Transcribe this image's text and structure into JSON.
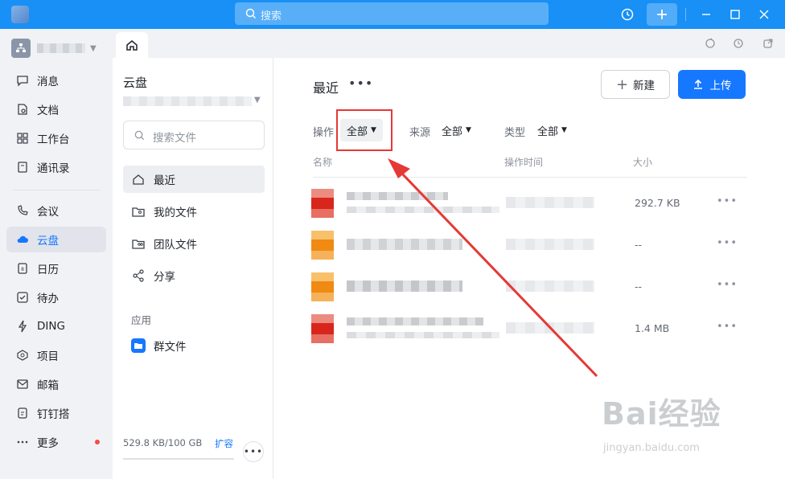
{
  "titlebar": {
    "search_placeholder": "搜索"
  },
  "leftnav": {
    "items": [
      {
        "label": "消息",
        "icon": "message-icon"
      },
      {
        "label": "文档",
        "icon": "document-icon"
      },
      {
        "label": "工作台",
        "icon": "workbench-icon"
      },
      {
        "label": "通讯录",
        "icon": "contacts-icon"
      },
      {
        "label": "会议",
        "icon": "meeting-icon"
      },
      {
        "label": "云盘",
        "icon": "cloud-icon",
        "active": true
      },
      {
        "label": "日历",
        "icon": "calendar-icon"
      },
      {
        "label": "待办",
        "icon": "todo-icon"
      },
      {
        "label": "DING",
        "icon": "ding-icon"
      },
      {
        "label": "项目",
        "icon": "project-icon"
      },
      {
        "label": "邮箱",
        "icon": "mail-icon"
      },
      {
        "label": "钉钉搭",
        "icon": "builder-icon"
      },
      {
        "label": "更多",
        "icon": "more-icon"
      }
    ]
  },
  "midpanel": {
    "title": "云盘",
    "search_placeholder": "搜索文件",
    "items": [
      {
        "label": "最近",
        "icon": "home-icon",
        "active": true
      },
      {
        "label": "我的文件",
        "icon": "my-files-icon"
      },
      {
        "label": "团队文件",
        "icon": "team-files-icon"
      },
      {
        "label": "分享",
        "icon": "share-icon"
      }
    ],
    "apps_section": "应用",
    "apps": [
      {
        "label": "群文件",
        "icon": "group-files-icon"
      }
    ],
    "storage": "529.8 KB/100 GB",
    "expand": "扩容"
  },
  "content": {
    "title": "最近",
    "new_button": "新建",
    "upload_button": "上传",
    "filters": {
      "operation": {
        "label": "操作",
        "value": "全部"
      },
      "source": {
        "label": "来源",
        "value": "全部"
      },
      "type": {
        "label": "类型",
        "value": "全部"
      }
    },
    "columns": {
      "name": "名称",
      "time": "操作时间",
      "size": "大小"
    },
    "rows": [
      {
        "size": "292.7 KB",
        "thumb_color": "#e0493e"
      },
      {
        "size": "--",
        "thumb_color": "#f59e2a"
      },
      {
        "size": "--",
        "thumb_color": "#f59e2a"
      },
      {
        "size": "1.4 MB",
        "thumb_color": "#e0493e"
      }
    ]
  },
  "watermark": {
    "brand": "Bai经验",
    "url": "jingyan.baidu.com"
  },
  "colors": {
    "accent": "#1677ff",
    "titlebar": "#1890f5",
    "annotation": "#e53935"
  }
}
